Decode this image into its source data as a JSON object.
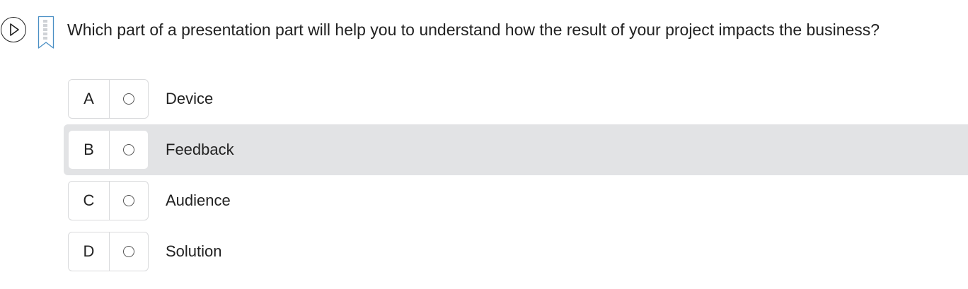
{
  "question": {
    "text": "Which part of a presentation part will help you to understand how the result of your project impacts the business?",
    "play_icon": "play-circle-icon",
    "bookmark_icon": "bookmark-icon"
  },
  "options": [
    {
      "letter": "A",
      "label": "Device",
      "highlighted": false
    },
    {
      "letter": "B",
      "label": "Feedback",
      "highlighted": true
    },
    {
      "letter": "C",
      "label": "Audience",
      "highlighted": false
    },
    {
      "letter": "D",
      "label": "Solution",
      "highlighted": false
    }
  ],
  "colors": {
    "highlight_background": "#e2e3e5",
    "bookmark_stroke": "#4a8fc4",
    "border": "#d9dadc"
  }
}
